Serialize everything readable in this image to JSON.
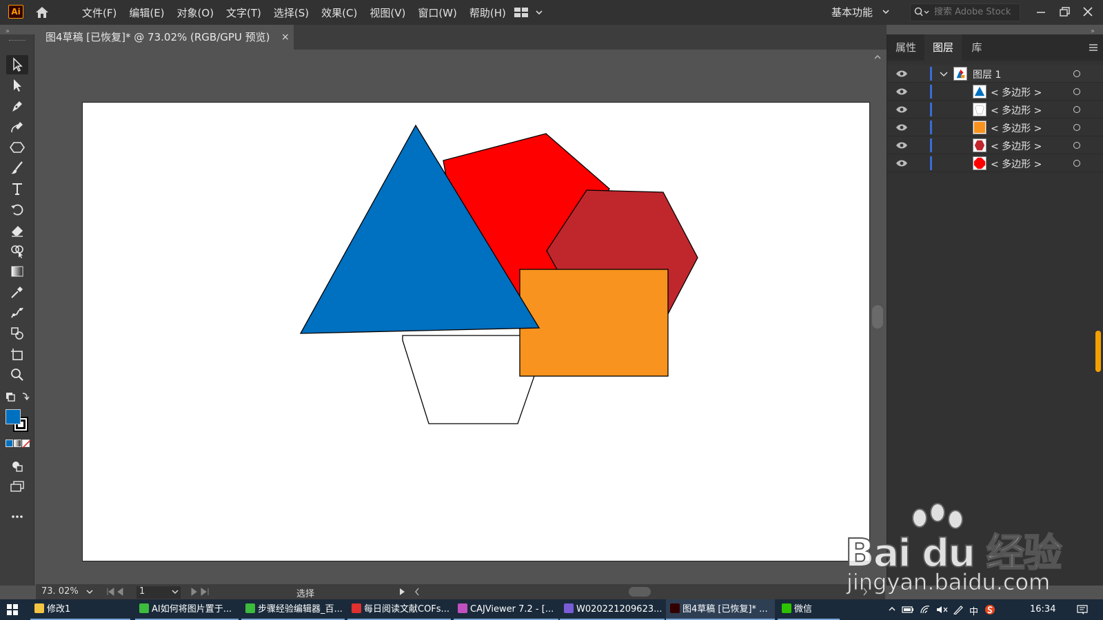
{
  "app": {
    "logo": "Ai",
    "menus": [
      "文件(F)",
      "编辑(E)",
      "对象(O)",
      "文字(T)",
      "选择(S)",
      "效果(C)",
      "视图(V)",
      "窗口(W)",
      "帮助(H)"
    ],
    "workspace": "基本功能",
    "search_placeholder": "搜索 Adobe Stock"
  },
  "document": {
    "tab_title": "图4草稿 [已恢复]* @ 73.02% (RGB/GPU 预览)",
    "close": "×"
  },
  "colors": {
    "fill": "#0070c0",
    "triangle": "#0070c0",
    "pentagon_red": "#ff0000",
    "hexagon": "#c0272d",
    "rectangle": "#f7931e",
    "pentagon_white": "#ffffff"
  },
  "status": {
    "zoom": "73. 02%",
    "page": "1",
    "tool": "选择"
  },
  "panel": {
    "tabs": [
      "属性",
      "图层",
      "库"
    ],
    "active_tab": "图层",
    "layer_name": "图层 1",
    "sublayers": [
      {
        "name": "< 多边形 >",
        "thumb_color": "#0070c0",
        "shape": "triangle"
      },
      {
        "name": "< 多边形 >",
        "thumb_color": "#ffffff",
        "shape": "pentagon"
      },
      {
        "name": "< 多边形 >",
        "thumb_color": "#f7931e",
        "shape": "rect"
      },
      {
        "name": "< 多边形 >",
        "thumb_color": "#c0272d",
        "shape": "hexagon"
      },
      {
        "name": "< 多边形 >",
        "thumb_color": "#ff0000",
        "shape": "octagon"
      }
    ]
  },
  "taskbar": {
    "items": [
      {
        "label": "修改1",
        "icon_color": "#f5c542"
      },
      {
        "label": "AI如何将图片置于...",
        "icon_color": "#3dbb3d"
      },
      {
        "label": "步骤经验编辑器_百...",
        "icon_color": "#3dbb3d"
      },
      {
        "label": "每日阅读文献COFs...",
        "icon_color": "#e03030"
      },
      {
        "label": "CAJViewer 7.2 - [...",
        "icon_color": "#c050c0"
      },
      {
        "label": "W020221209623...",
        "icon_color": "#7a5cd6"
      },
      {
        "label": "图4草稿 [已恢复]* ...",
        "icon_color": "#330000"
      },
      {
        "label": "微信",
        "icon_color": "#2dc100"
      }
    ],
    "tray_ime": "中",
    "time": "16:34"
  },
  "watermark": {
    "brand": "Bai du 经验",
    "url": "jingyan.baidu.com"
  }
}
